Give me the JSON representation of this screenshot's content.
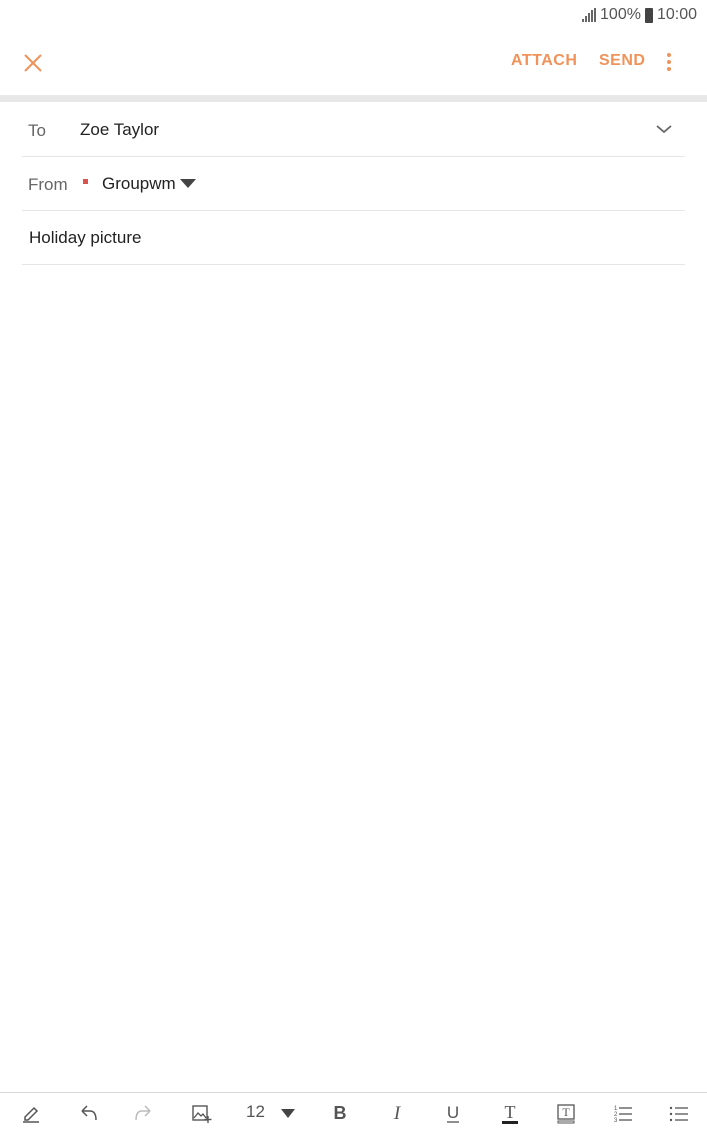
{
  "status": {
    "battery": "100%",
    "time": "10:00"
  },
  "app_bar": {
    "attach_label": "ATTACH",
    "send_label": "SEND"
  },
  "compose": {
    "to_label": "To",
    "to_value": "Zoe Taylor",
    "from_label": "From",
    "from_value": "Groupwm",
    "subject": "Holiday picture"
  },
  "toolbar": {
    "font_size": "12"
  },
  "colors": {
    "accent": "#f0935a",
    "account_dot": "#d9534f"
  }
}
